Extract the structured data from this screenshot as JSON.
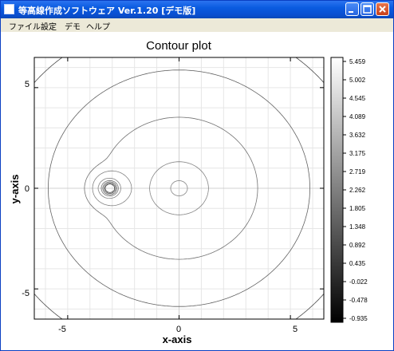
{
  "window": {
    "title": "等高線作成ソフトウェア Ver.1.20 [デモ版]"
  },
  "menu": [
    {
      "label": "ファイル"
    },
    {
      "label": "設定"
    },
    {
      "label": "デモ"
    },
    {
      "label": "ヘルプ"
    }
  ],
  "chart_data": {
    "type": "contour",
    "title": "Contour plot",
    "xlabel": "x-axis",
    "ylabel": "y-axis",
    "xlim": [
      -6.5,
      6.5
    ],
    "ylim": [
      -6.5,
      6.5
    ],
    "xticks": [
      "-5",
      "0",
      "5"
    ],
    "yticks": [
      "5",
      "0",
      "-5"
    ],
    "grid": true,
    "colorbar": {
      "colormap": "gray",
      "min": -0.935,
      "max": 5.459,
      "labels": [
        "5.459",
        "5.002",
        "4.545",
        "4.089",
        "3.632",
        "3.175",
        "2.719",
        "2.262",
        "1.805",
        "1.348",
        "0.892",
        "0.435",
        "-0.022",
        "-0.478",
        "-0.935"
      ]
    },
    "series": [
      {
        "values": [
          0.2,
          0.5,
          0.9,
          1.3,
          1.8,
          2.3,
          2.8,
          3.3
        ]
      }
    ],
    "features": {
      "sink_center": [
        -3.1,
        0
      ],
      "ring_center": [
        0,
        0
      ]
    }
  }
}
